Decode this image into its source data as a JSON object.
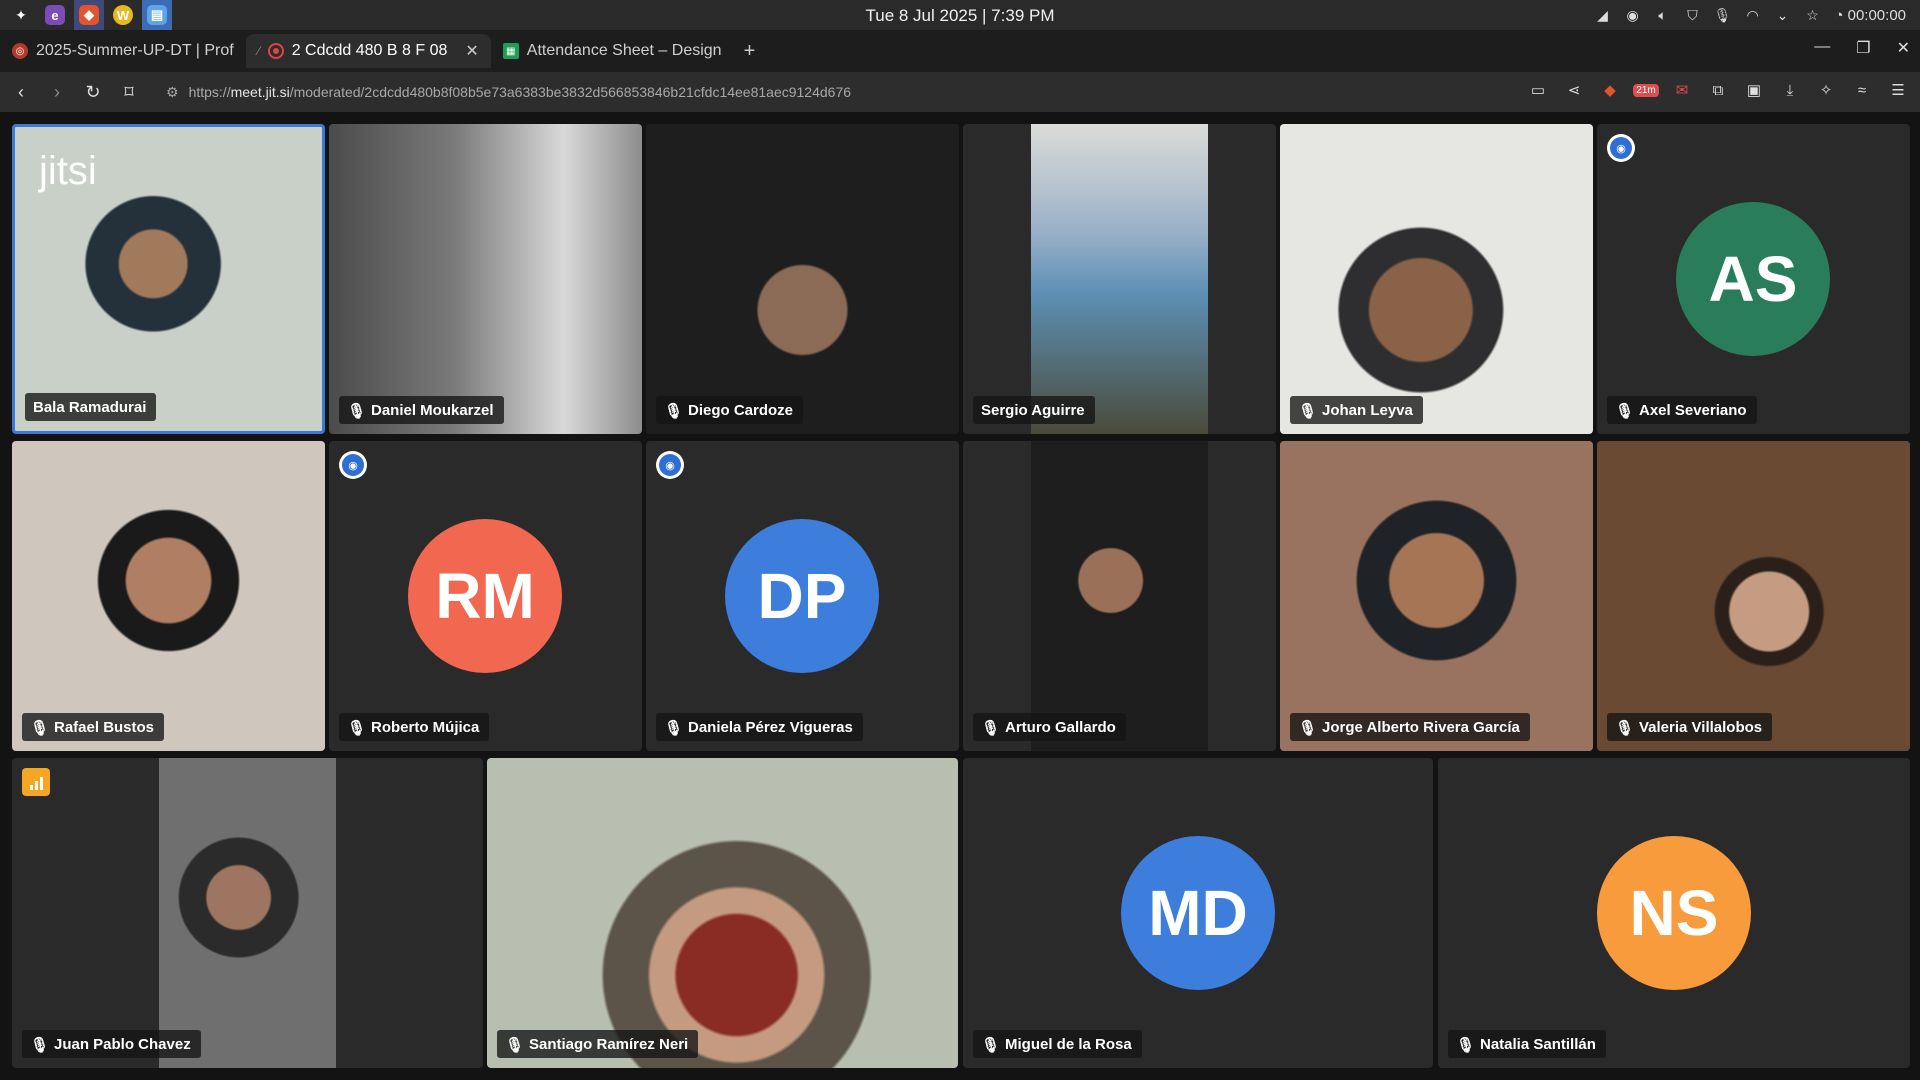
{
  "system": {
    "clock": "Tue 8 Jul 2025 | 7:39 PM",
    "timer": "00:00:00"
  },
  "browser": {
    "tabs": [
      {
        "label": "2025-Summer-UP-DT | Prof",
        "active": false
      },
      {
        "label": "2 Cdcdd 480 B 8 F 08",
        "active": true
      },
      {
        "label": "Attendance Sheet – Design",
        "active": false
      }
    ],
    "url_scheme": "https://",
    "url_host": "meet.jit.si",
    "url_path": "/moderated/2cdcdd480b8f08b5e73a6383be3832d566853846b21cfdc14ee81aec9124d676",
    "badge_21m": "21m"
  },
  "meeting": {
    "logo": "jitsi",
    "participants": [
      {
        "name": "Bala Ramadurai",
        "type": "video",
        "muted": false
      },
      {
        "name": "Daniel Moukarzel",
        "type": "video",
        "muted": true
      },
      {
        "name": "Diego Cardoze",
        "type": "video",
        "muted": true
      },
      {
        "name": "Sergio Aguirre",
        "type": "video",
        "muted": false
      },
      {
        "name": "Johan Leyva",
        "type": "video",
        "muted": true
      },
      {
        "name": "Axel Severiano",
        "type": "avatar",
        "initials": "AS",
        "color": "#2a7d5a",
        "muted": true
      },
      {
        "name": "Rafael Bustos",
        "type": "video",
        "muted": true
      },
      {
        "name": "Roberto Mújica",
        "type": "avatar",
        "initials": "RM",
        "color": "#f2674f",
        "muted": true
      },
      {
        "name": "Daniela Pérez Vigueras",
        "type": "avatar",
        "initials": "DP",
        "color": "#3d7ddb",
        "muted": true
      },
      {
        "name": "Arturo Gallardo",
        "type": "video",
        "muted": true
      },
      {
        "name": "Jorge Alberto Rivera García",
        "type": "video",
        "muted": true
      },
      {
        "name": "Valeria Villalobos",
        "type": "video",
        "muted": true
      },
      {
        "name": "Juan Pablo Chavez",
        "type": "video",
        "muted": true
      },
      {
        "name": "Santiago Ramírez Neri",
        "type": "video",
        "muted": true
      },
      {
        "name": "Miguel de la Rosa",
        "type": "avatar",
        "initials": "MD",
        "color": "#3d7ddb",
        "muted": true
      },
      {
        "name": "Natalia Santillán",
        "type": "avatar",
        "initials": "NS",
        "color": "#f79b3d",
        "muted": true
      }
    ]
  }
}
